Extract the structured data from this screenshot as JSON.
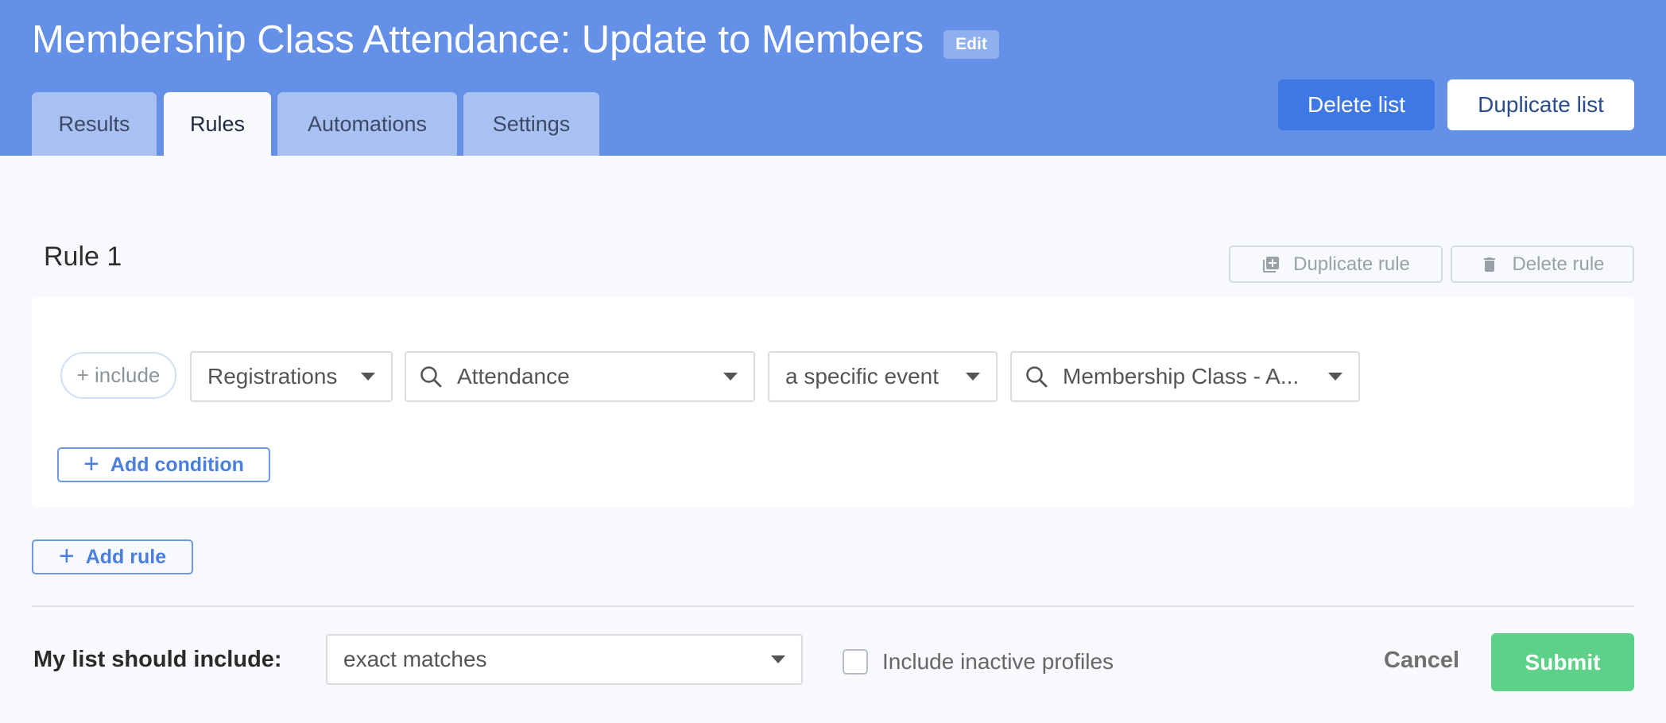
{
  "header": {
    "title": "Membership Class Attendance: Update to Members",
    "edit_label": "Edit",
    "tabs": [
      {
        "label": "Results"
      },
      {
        "label": "Rules"
      },
      {
        "label": "Automations"
      },
      {
        "label": "Settings"
      }
    ],
    "active_tab": "Rules",
    "delete_list_label": "Delete list",
    "duplicate_list_label": "Duplicate list"
  },
  "rule": {
    "title": "Rule 1",
    "duplicate_rule_label": "Duplicate rule",
    "delete_rule_label": "Delete rule",
    "include_label": "+ include",
    "conditions": [
      {
        "category": "Registrations",
        "field": "Attendance",
        "operator": "a specific event",
        "value": "Membership Class - A..."
      }
    ],
    "add_condition_label": "Add condition"
  },
  "add_rule_label": "Add rule",
  "footer": {
    "include_label": "My list should include:",
    "match_mode": "exact matches",
    "inactive_label": "Include inactive profiles",
    "inactive_checked": false,
    "cancel_label": "Cancel",
    "submit_label": "Submit"
  },
  "colors": {
    "header_bg": "#6590e8",
    "primary": "#3e78e4",
    "submit": "#5dd187"
  },
  "icons": {
    "duplicate": "duplicate-icon",
    "delete": "trash-icon",
    "search": "search-icon",
    "plus": "plus-icon"
  }
}
